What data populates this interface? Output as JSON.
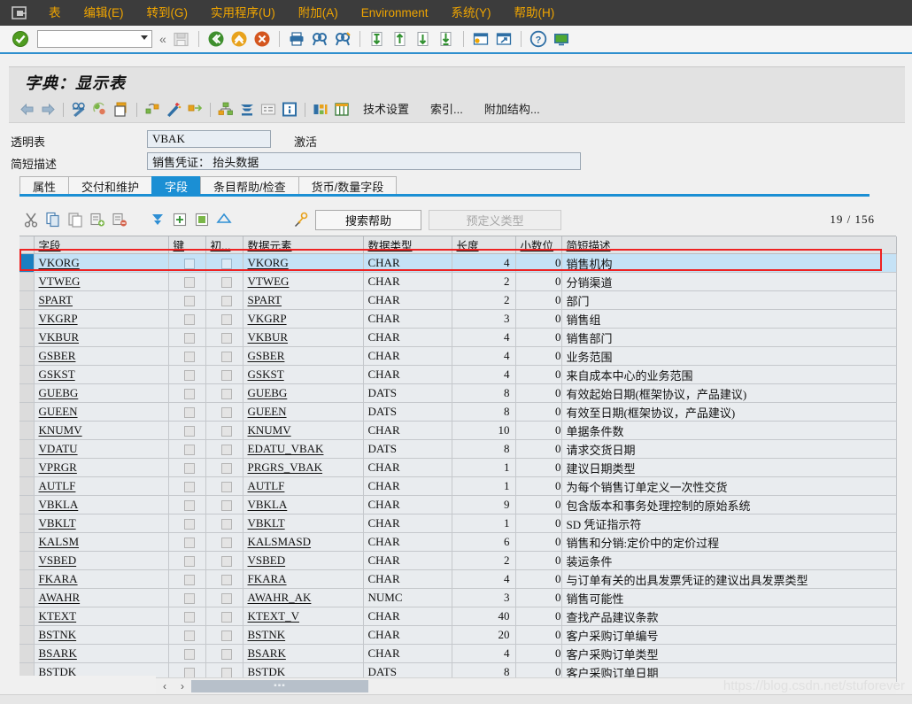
{
  "menubar": {
    "system_icon": "table-menu-icon",
    "items": [
      {
        "label": "表",
        "name": "menu-table"
      },
      {
        "label": "编辑(E)",
        "name": "menu-edit"
      },
      {
        "label": "转到(G)",
        "name": "menu-goto"
      },
      {
        "label": "实用程序(U)",
        "name": "menu-utilities"
      },
      {
        "label": "附加(A)",
        "name": "menu-extras"
      },
      {
        "label": "Environment",
        "name": "menu-environment"
      },
      {
        "label": "系统(Y)",
        "name": "menu-system"
      },
      {
        "label": "帮助(H)",
        "name": "menu-help"
      }
    ]
  },
  "toolbar": {
    "command_value": "",
    "command_placeholder": "",
    "icons": [
      "enter-check-icon",
      "back-green-icon",
      "exit-yellow-icon",
      "cancel-red-icon",
      "print-icon",
      "find-icon",
      "find-next-icon",
      "first-page-icon",
      "previous-page-icon",
      "next-page-icon",
      "last-page-icon",
      "create-session-icon",
      "create-shortcut-icon",
      "help-icon",
      "customize-icon"
    ]
  },
  "title": {
    "text": "字典：显示表"
  },
  "apptoolbar": {
    "icons": [
      "back-arrow-icon",
      "forward-arrow-icon",
      "display-change-icon",
      "refresh-icon",
      "clipboard-paste-icon",
      "hierarchy-icon",
      "wand-icon",
      "expand-icon",
      "structure-icon",
      "stack-icon",
      "list-icon",
      "info-icon",
      "field-detail-icon",
      "table-grid-icon"
    ],
    "buttons": [
      {
        "label": "技术设置",
        "name": "technical-settings-button"
      },
      {
        "label": "索引...",
        "name": "indexes-button"
      },
      {
        "label": "附加结构...",
        "name": "append-structure-button"
      }
    ]
  },
  "form": {
    "table_type_label": "透明表",
    "table_name": "VBAK",
    "status": "激活",
    "short_desc_label": "简短描述",
    "short_desc": "销售凭证： 抬头数据"
  },
  "tabs": [
    {
      "label": "属性",
      "name": "tab-attributes",
      "active": false
    },
    {
      "label": "交付和维护",
      "name": "tab-delivery-maintenance",
      "active": false
    },
    {
      "label": "字段",
      "name": "tab-fields",
      "active": true
    },
    {
      "label": "条目帮助/检查",
      "name": "tab-entry-help-check",
      "active": false
    },
    {
      "label": "货币/数量字段",
      "name": "tab-currency-quantity-fields",
      "active": false
    }
  ],
  "gridbar": {
    "icons": [
      "cut-icon",
      "copy-icon",
      "paste-icon",
      "insert-row-icon",
      "delete-row-icon",
      "filter-down-icon",
      "insert-field-icon",
      "copy-field-icon",
      "sort-up-icon",
      "key-icon"
    ],
    "search_help_button": "搜索帮助",
    "predefined_type_button": "预定义类型",
    "counter": "19 / 156",
    "counter_current": "19",
    "counter_total": "156"
  },
  "grid": {
    "columns": [
      {
        "label": "字段",
        "name": "col-field"
      },
      {
        "label": "键",
        "name": "col-key"
      },
      {
        "label": "初...",
        "name": "col-initial"
      },
      {
        "label": "数据元素",
        "name": "col-data-element"
      },
      {
        "label": "数据类型",
        "name": "col-data-type"
      },
      {
        "label": "长度",
        "name": "col-length"
      },
      {
        "label": "小数位",
        "name": "col-decimals"
      },
      {
        "label": "简短描述",
        "name": "col-short-description"
      }
    ],
    "rows": [
      {
        "field": "VKORG",
        "key": false,
        "initial": false,
        "data_element": "VKORG",
        "data_type": "CHAR",
        "length": "4",
        "decimals": "0",
        "description": "销售机构",
        "selected": true
      },
      {
        "field": "VTWEG",
        "key": false,
        "initial": false,
        "data_element": "VTWEG",
        "data_type": "CHAR",
        "length": "2",
        "decimals": "0",
        "description": "分销渠道",
        "selected": false
      },
      {
        "field": "SPART",
        "key": false,
        "initial": false,
        "data_element": "SPART",
        "data_type": "CHAR",
        "length": "2",
        "decimals": "0",
        "description": "部门",
        "selected": false
      },
      {
        "field": "VKGRP",
        "key": false,
        "initial": false,
        "data_element": "VKGRP",
        "data_type": "CHAR",
        "length": "3",
        "decimals": "0",
        "description": "销售组",
        "selected": false
      },
      {
        "field": "VKBUR",
        "key": false,
        "initial": false,
        "data_element": "VKBUR",
        "data_type": "CHAR",
        "length": "4",
        "decimals": "0",
        "description": "销售部门",
        "selected": false
      },
      {
        "field": "GSBER",
        "key": false,
        "initial": false,
        "data_element": "GSBER",
        "data_type": "CHAR",
        "length": "4",
        "decimals": "0",
        "description": "业务范围",
        "selected": false
      },
      {
        "field": "GSKST",
        "key": false,
        "initial": false,
        "data_element": "GSKST",
        "data_type": "CHAR",
        "length": "4",
        "decimals": "0",
        "description": "来自成本中心的业务范围",
        "selected": false
      },
      {
        "field": "GUEBG",
        "key": false,
        "initial": false,
        "data_element": "GUEBG",
        "data_type": "DATS",
        "length": "8",
        "decimals": "0",
        "description": "有效起始日期(框架协议，产品建议)",
        "selected": false
      },
      {
        "field": "GUEEN",
        "key": false,
        "initial": false,
        "data_element": "GUEEN",
        "data_type": "DATS",
        "length": "8",
        "decimals": "0",
        "description": "有效至日期(框架协议，产品建议)",
        "selected": false
      },
      {
        "field": "KNUMV",
        "key": false,
        "initial": false,
        "data_element": "KNUMV",
        "data_type": "CHAR",
        "length": "10",
        "decimals": "0",
        "description": "单据条件数",
        "selected": false
      },
      {
        "field": "VDATU",
        "key": false,
        "initial": false,
        "data_element": "EDATU_VBAK",
        "data_type": "DATS",
        "length": "8",
        "decimals": "0",
        "description": "请求交货日期",
        "selected": false
      },
      {
        "field": "VPRGR",
        "key": false,
        "initial": false,
        "data_element": "PRGRS_VBAK",
        "data_type": "CHAR",
        "length": "1",
        "decimals": "0",
        "description": "建议日期类型",
        "selected": false
      },
      {
        "field": "AUTLF",
        "key": false,
        "initial": false,
        "data_element": "AUTLF",
        "data_type": "CHAR",
        "length": "1",
        "decimals": "0",
        "description": "为每个销售订单定义一次性交货",
        "selected": false
      },
      {
        "field": "VBKLA",
        "key": false,
        "initial": false,
        "data_element": "VBKLA",
        "data_type": "CHAR",
        "length": "9",
        "decimals": "0",
        "description": "包含版本和事务处理控制的原始系统",
        "selected": false
      },
      {
        "field": "VBKLT",
        "key": false,
        "initial": false,
        "data_element": "VBKLT",
        "data_type": "CHAR",
        "length": "1",
        "decimals": "0",
        "description": "SD 凭证指示符",
        "selected": false
      },
      {
        "field": "KALSM",
        "key": false,
        "initial": false,
        "data_element": "KALSMASD",
        "data_type": "CHAR",
        "length": "6",
        "decimals": "0",
        "description": "销售和分销:定价中的定价过程",
        "selected": false
      },
      {
        "field": "VSBED",
        "key": false,
        "initial": false,
        "data_element": "VSBED",
        "data_type": "CHAR",
        "length": "2",
        "decimals": "0",
        "description": "装运条件",
        "selected": false
      },
      {
        "field": "FKARA",
        "key": false,
        "initial": false,
        "data_element": "FKARA",
        "data_type": "CHAR",
        "length": "4",
        "decimals": "0",
        "description": "与订单有关的出具发票凭证的建议出具发票类型",
        "selected": false
      },
      {
        "field": "AWAHR",
        "key": false,
        "initial": false,
        "data_element": "AWAHR_AK",
        "data_type": "NUMC",
        "length": "3",
        "decimals": "0",
        "description": "销售可能性",
        "selected": false
      },
      {
        "field": "KTEXT",
        "key": false,
        "initial": false,
        "data_element": "KTEXT_V",
        "data_type": "CHAR",
        "length": "40",
        "decimals": "0",
        "description": "查找产品建议条款",
        "selected": false
      },
      {
        "field": "BSTNK",
        "key": false,
        "initial": false,
        "data_element": "BSTNK",
        "data_type": "CHAR",
        "length": "20",
        "decimals": "0",
        "description": "客户采购订单编号",
        "selected": false
      },
      {
        "field": "BSARK",
        "key": false,
        "initial": false,
        "data_element": "BSARK",
        "data_type": "CHAR",
        "length": "4",
        "decimals": "0",
        "description": "客户采购订单类型",
        "selected": false
      },
      {
        "field": "BSTDK",
        "key": false,
        "initial": false,
        "data_element": "BSTDK",
        "data_type": "DATS",
        "length": "8",
        "decimals": "0",
        "description": "客户采购订单日期",
        "selected": false
      }
    ]
  },
  "scrollbar": {
    "left_arrow": "‹",
    "right_arrow": "›",
    "thumb_glyph": "▪▪▪"
  },
  "watermark": "https://blog.csdn.net/stuforever",
  "colors": {
    "menubar_bg": "#3c3c3c",
    "menu_text": "#f0a500",
    "accent_blue": "#1b8fd4",
    "selection_blue": "#c5e2f6",
    "highlight_red": "#ee2222",
    "grid_bg": "#e9ecef"
  }
}
